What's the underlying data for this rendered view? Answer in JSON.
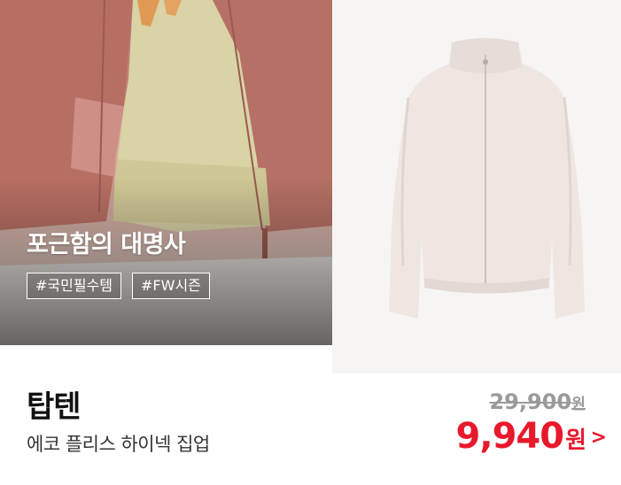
{
  "promo": {
    "headline": "포근함의 대명사",
    "tags": [
      "#국민필수템",
      "#FW시즌"
    ]
  },
  "product": {
    "brand": "탑텐",
    "name": "에코 플리스 하이넥 집업",
    "original_price": "29,900",
    "original_price_unit": "원",
    "sale_price": "9,940",
    "sale_price_unit": "원",
    "arrow": ">"
  },
  "colors": {
    "sale": "#e8192c",
    "original": "#9a9a9a",
    "brand": "#111111"
  },
  "icons": [
    "chevron-right-icon"
  ]
}
